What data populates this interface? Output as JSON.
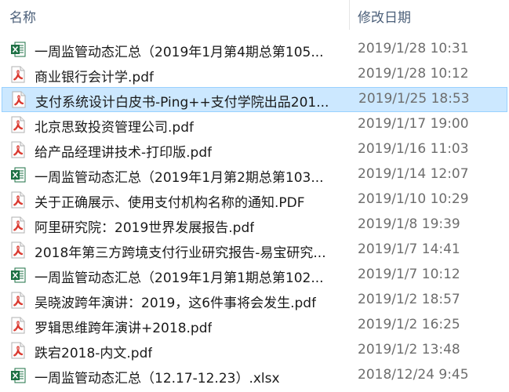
{
  "header": {
    "name_label": "名称",
    "date_label": "修改日期"
  },
  "files": [
    {
      "name": "一周监管动态汇总（2019年1月第4期总第105...",
      "date": "2019/1/28 10:31",
      "type": "xlsx-icon"
    },
    {
      "name": "商业银行会计学.pdf",
      "date": "2019/1/28 10:12",
      "type": "pdf-icon"
    },
    {
      "name": "支付系统设计白皮书-Ping++支付学院出品201...",
      "date": "2019/1/25 18:53",
      "type": "pdf-icon",
      "selected": true
    },
    {
      "name": "北京思致投资管理公司.pdf",
      "date": "2019/1/17 19:00",
      "type": "pdf-icon"
    },
    {
      "name": "给产品经理讲技术-打印版.pdf",
      "date": "2019/1/16 11:03",
      "type": "pdf-icon"
    },
    {
      "name": "一周监管动态汇总（2019年1月第2期总第103...",
      "date": "2019/1/14 12:07",
      "type": "xlsx-icon"
    },
    {
      "name": "关于正确展示、使用支付机构名称的通知.PDF",
      "date": "2019/1/10 10:29",
      "type": "pdf-icon"
    },
    {
      "name": "阿里研究院：2019世界发展报告.pdf",
      "date": "2019/1/8 19:39",
      "type": "pdf-icon"
    },
    {
      "name": "2018年第三方跨境支付行业研究报告-易宝研究...",
      "date": "2019/1/7 14:41",
      "type": "pdf-icon"
    },
    {
      "name": "一周监管动态汇总（2019年1月第1期总第102...",
      "date": "2019/1/7 10:12",
      "type": "xlsx-icon"
    },
    {
      "name": "吴晓波跨年演讲：2019，这6件事将会发生.pdf",
      "date": "2019/1/2 18:57",
      "type": "pdf-icon"
    },
    {
      "name": "罗辑思维跨年演讲+2018.pdf",
      "date": "2019/1/2 16:25",
      "type": "pdf-icon"
    },
    {
      "name": "跌宕2018-内文.pdf",
      "date": "2019/1/2 13:48",
      "type": "pdf-icon"
    },
    {
      "name": "一周监管动态汇总（12.17-12.23）.xlsx",
      "date": "2018/12/24 9:45",
      "type": "xlsx-icon"
    }
  ],
  "colors": {
    "selected_bg": "#cce8ff",
    "selected_border": "#99d1ff",
    "pdf_red": "#d9352b",
    "excel_green": "#1d7044"
  }
}
